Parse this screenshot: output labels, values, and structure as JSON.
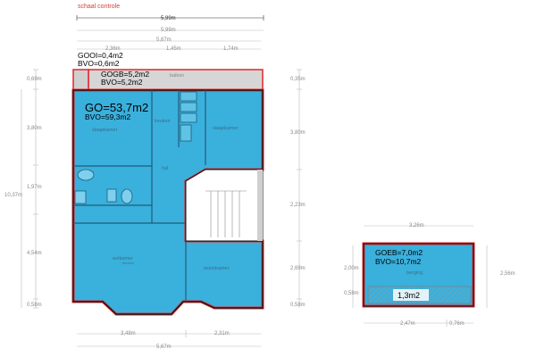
{
  "header": {
    "check_label": "schaal controle"
  },
  "colors": {
    "room_fill": "#3ab0dc",
    "outline_red": "#e3262b",
    "dim_gray": "#8a8a8a",
    "balcony_gray": "#d6d6d6"
  },
  "dimensions": {
    "top": {
      "overall": "5,99m",
      "second": "5,99m",
      "third": "5,67m",
      "segment_a": "2,36m",
      "segment_b": "1,45m",
      "segment_c": "1,74m"
    },
    "bottom": {
      "segment_a": "3,48m",
      "segment_b": "2,31m",
      "overall": "5,67m"
    },
    "left": {
      "balcony": "0,69m",
      "upper": "3,80m",
      "middle": "1,97m",
      "total": "10,37m",
      "lower": "4,54m",
      "base": "0,58m"
    },
    "right": {
      "balcony": "0,35m",
      "upper": "3,80m",
      "stair": "2,23m",
      "lower": "2,69m",
      "base": "0,58m"
    },
    "shed": {
      "top": "3,26m",
      "left_upper": "2,00m",
      "left_lower": "0,58m",
      "right": "2,56m",
      "bottom_a": "2,47m",
      "bottom_b": "0,76m"
    }
  },
  "area_labels": {
    "gooi": "GOOI=0,4m2",
    "bvo_small": "BVO=0,6m2",
    "gogb": "GOGB=5,2m2",
    "bvo_balcony": "BVO=5,2m2",
    "go": "GO=53,7m2",
    "bvo_main": "BVO=59,3m2",
    "goeb": "GOEB=7,0m2",
    "bvo_shed": "BVO=10,7m2",
    "low_height": "1,3m2"
  },
  "rooms": {
    "slaapkamer_left": "slaapkamer",
    "keuken": "keuken",
    "slaapkamer_right": "slaapkamer",
    "hal": "hal",
    "eetkamer": "eetkamer",
    "keuken_small": "keuken",
    "woonkamer": "woonkamer",
    "berging": "berging",
    "balkon": "balkon"
  }
}
